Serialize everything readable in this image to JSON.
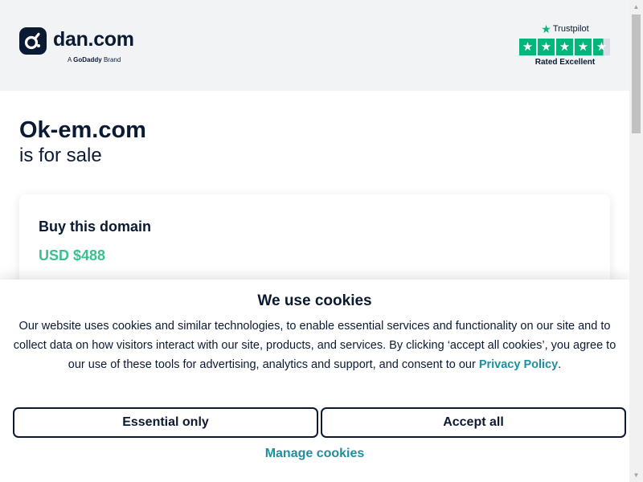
{
  "header": {
    "logo_text": "dan.com",
    "brand_prefix": "A",
    "brand_name": "GoDaddy",
    "brand_suffix": "Brand",
    "trustpilot": {
      "label": "Trustpilot",
      "rating_text": "Rated Excellent",
      "stars": 4.5,
      "star_color": "#00b67a"
    }
  },
  "main": {
    "domain": "Ok-em.com",
    "subtitle": "is for sale",
    "buy_card": {
      "title": "Buy this domain",
      "price": "USD $488",
      "price_color": "#3cbf8f"
    }
  },
  "cookie_banner": {
    "title": "We use cookies",
    "body": "Our website uses cookies and similar technologies, to enable essential services and functionality on our site and to collect data on how visitors interact with our site, products, and services. By clicking ‘accept all cookies’, you agree to our use of these tools for advertising, analytics and support, and consent to our",
    "privacy_link": "Privacy Policy",
    "period": ".",
    "essential_label": "Essential only",
    "accept_label": "Accept all",
    "manage_label": "Manage cookies",
    "link_color": "#1f8fa0"
  },
  "icons": {
    "logo": "dan-logo-icon",
    "star": "star-icon"
  }
}
